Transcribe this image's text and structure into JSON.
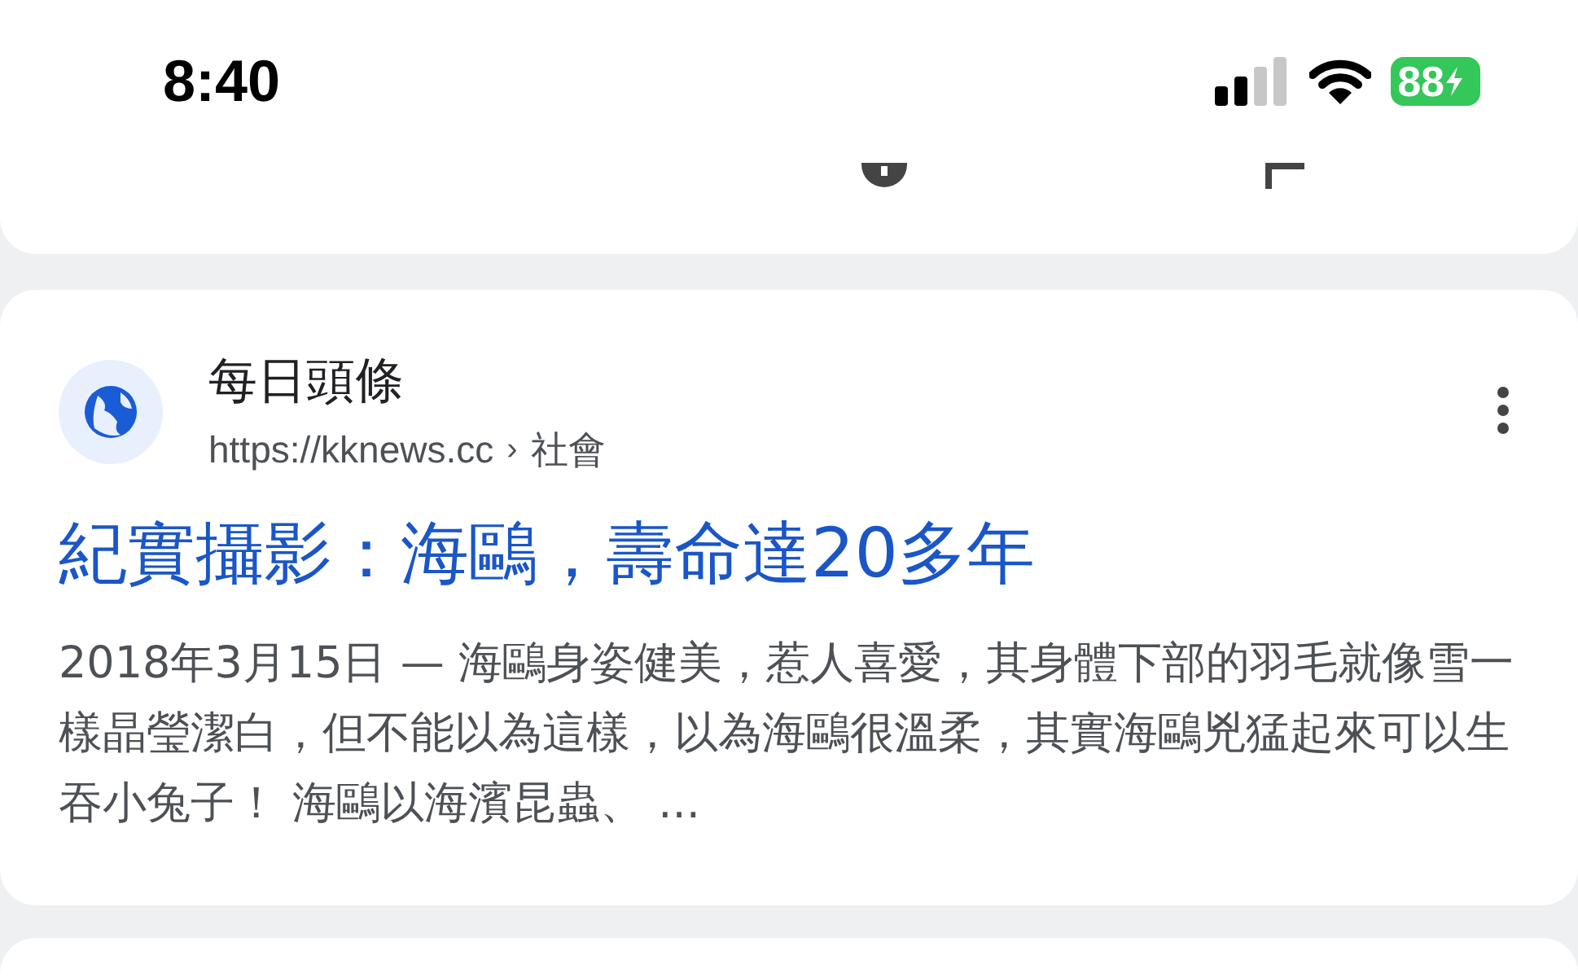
{
  "status_bar": {
    "time": "8:40",
    "battery": "88"
  },
  "previous_card": {
    "links": [
      {
        "kind": "info"
      },
      {
        "kind": "feedback"
      }
    ]
  },
  "result": {
    "site_name": "每日頭條",
    "url": "https://kknews.cc",
    "separator": "›",
    "breadcrumb": "社會",
    "title": "紀實攝影：海鷗，壽命達20多年",
    "snippet": "2018年3月15日 — 海鷗身姿健美，惹人喜愛，其身體下部的羽毛就像雪一樣晶瑩潔白，但不能以為這樣，以為海鷗很溫柔，其實海鷗兇猛起來可以生吞小兔子！ 海鷗以海濱昆蟲、 ..."
  }
}
